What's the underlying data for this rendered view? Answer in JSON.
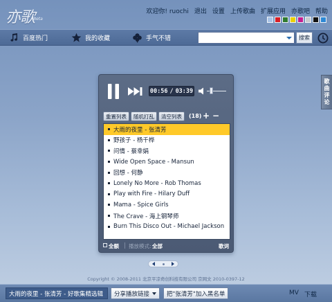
{
  "app": {
    "logo_text": "亦歌",
    "logo_badge": "Beta"
  },
  "top_links": [
    "欢迎你! ruochi",
    "退出",
    "设置",
    "上传歌曲",
    "扩展应用",
    "亦歌吧",
    "帮助"
  ],
  "theme_swatches": [
    "#a9c3e6",
    "#d81f26",
    "#2f7a2f",
    "#ecd100",
    "#c51e8f",
    "#c8cccf",
    "#111111",
    "#2d88d4"
  ],
  "nav": {
    "items": [
      {
        "label": "百度热门",
        "icon": "music-note-icon"
      },
      {
        "label": "我的收藏",
        "icon": "star-icon"
      },
      {
        "label": "手气不错",
        "icon": "clover-icon"
      }
    ],
    "search_value": "",
    "search_placeholder": "",
    "search_button": "搜索",
    "clock_icon": "clock-icon"
  },
  "side_tab": {
    "chars": [
      "歌",
      "曲",
      "评",
      "论"
    ]
  },
  "player": {
    "state": "playing",
    "time_current": "00:56",
    "time_separator": "/",
    "time_total": "03:39",
    "volume": 0.15,
    "toolbar": {
      "reset_label": "重置列表",
      "shuffle_label": "随机打乱",
      "clear_label": "清空列表",
      "count": "(18)",
      "plus": "+",
      "minus": "−"
    },
    "songs": [
      {
        "title": "大雨的夜里 - 张清芳",
        "active": true
      },
      {
        "title": "野孩子 - 杨千桦",
        "active": false
      },
      {
        "title": "问情 - 蔡幸娟",
        "active": false
      },
      {
        "title": "Wide Open Space - Mansun",
        "active": false
      },
      {
        "title": "回想 - 何静",
        "active": false
      },
      {
        "title": "Lonely No More - Rob Thomas",
        "active": false
      },
      {
        "title": "Play with Fire - Hilary Duff",
        "active": false
      },
      {
        "title": "Mama - Spice Girls",
        "active": false
      },
      {
        "title": "The Crave - 海上钢琴师",
        "active": false
      },
      {
        "title": "Burn This Disco Out - Michael Jackson",
        "active": false
      }
    ],
    "footer": {
      "select_all": "全额",
      "mode_label": "播放模式:",
      "mode_value": "全部",
      "lyrics": "歌词"
    }
  },
  "copyright": "Copyright © 2008-2011 北京平凉奇创科技有限公司    京网文 2010-0397-12",
  "bottom": {
    "now_playing": "大雨的夜里 - 张清芳 - 好歌集精选辑",
    "share_label": "分享播放链接",
    "blacklist_label": "把\"张清芳\"加入黑名单",
    "mv_label": "MV",
    "download_label": "下载"
  }
}
